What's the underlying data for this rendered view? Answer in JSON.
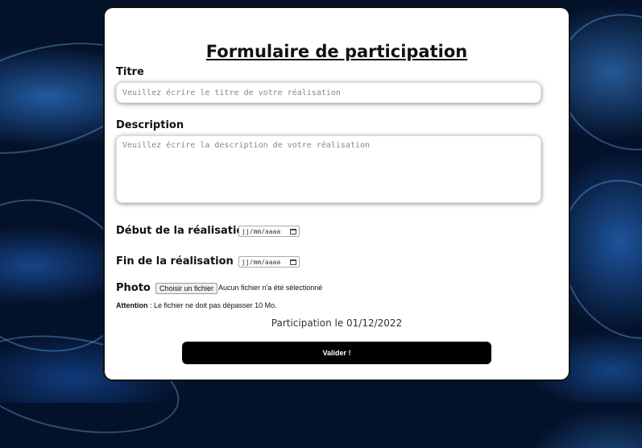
{
  "form": {
    "title": "Formulaire de participation",
    "titre_label": "Titre",
    "titre_placeholder": "Veuillez écrire le titre de votre réalisation",
    "description_label": "Description",
    "description_placeholder": "Veuillez écrire la description de votre réalisation",
    "debut_label": "Début de la réalisation",
    "debut_placeholder": "jj/mm/aaaa",
    "fin_label": "Fin de la réalisation",
    "fin_placeholder": "jj/mm/aaaa",
    "photo_label": "Photo",
    "file_button": "Choisir un fichier",
    "file_status": "Aucun fichier n'a été sélectionné",
    "attention_label": "Attention",
    "attention_text": " : Le fichier ne doit pas dépasser 10 Mo.",
    "participation_date": "Participation le 01/12/2022",
    "submit_label": "Valider !"
  },
  "icons": {
    "calendar": "calendar-icon"
  },
  "colors": {
    "background": "#04112a",
    "accent_glow": "#3c96ff",
    "card": "#ffffff",
    "button": "#000000"
  }
}
